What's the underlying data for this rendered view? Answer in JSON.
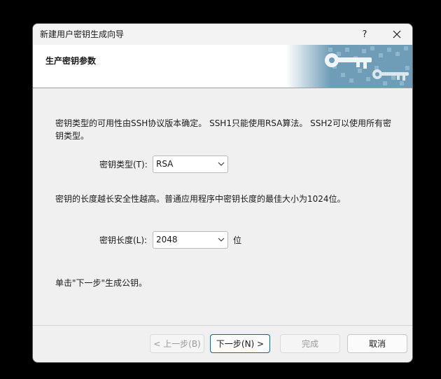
{
  "window": {
    "title": "新建用户密钥生成向导",
    "help_label": "?"
  },
  "header": {
    "title": "生产密钥参数"
  },
  "body": {
    "type_description": "密钥类型的可用性由SSH协议版本确定。 SSH1只能使用RSA算法。 SSH2可以使用所有密钥类型。",
    "type_label": "密钥类型(T):",
    "type_value": "RSA",
    "length_description": "密钥的长度越长安全性越高。普通应用程序中密钥长度的最佳大小为1024位。",
    "length_label": "密钥长度(L):",
    "length_value": "2048",
    "length_unit": "位",
    "hint": "单击\"下一步\"生成公钥。"
  },
  "buttons": {
    "back": "< 上一步(B)",
    "next": "下一步(N) >",
    "finish": "完成",
    "cancel": "取消"
  },
  "icons": {
    "close": "close-icon",
    "dropdown": "chevron-down-icon",
    "header_art": "keys-icon"
  },
  "colors": {
    "accent": "#0067c0",
    "header_art": "#5b8fae"
  }
}
